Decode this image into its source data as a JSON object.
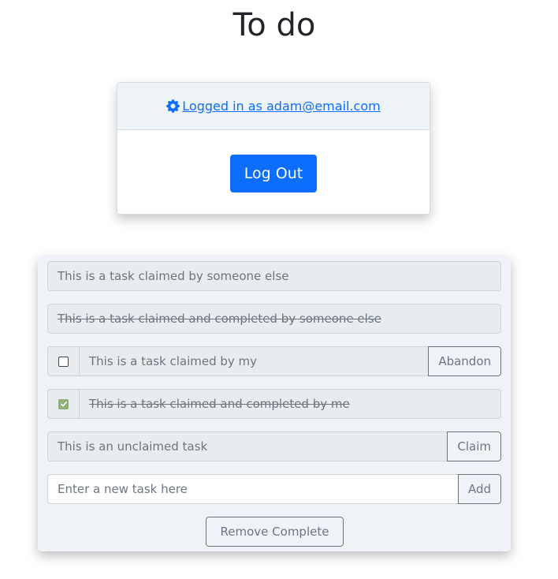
{
  "header": {
    "title": "To do"
  },
  "auth": {
    "user_link": " Logged in as adam@email.com",
    "logout_label": "Log Out",
    "gear_icon": "gear-icon",
    "link_color": "#0d6efd",
    "button_color": "#0d6efd"
  },
  "tasks": {
    "items": [
      {
        "text": "This is a task claimed by someone else",
        "state": "claimed-other"
      },
      {
        "text": "This is a task claimed and completed by someone else",
        "state": "completed-other"
      },
      {
        "text": "This is a task claimed by my",
        "state": "claimed-mine",
        "checked": false,
        "action": "Abandon"
      },
      {
        "text": "This is a task claimed and completed by me",
        "state": "completed-mine",
        "checked": true
      },
      {
        "text": "This is an unclaimed task",
        "state": "unclaimed",
        "action": "Claim"
      }
    ],
    "new_task": {
      "placeholder": "Enter a new task here",
      "value": "",
      "add_label": "Add"
    },
    "remove_complete_label": "Remove Complete"
  }
}
